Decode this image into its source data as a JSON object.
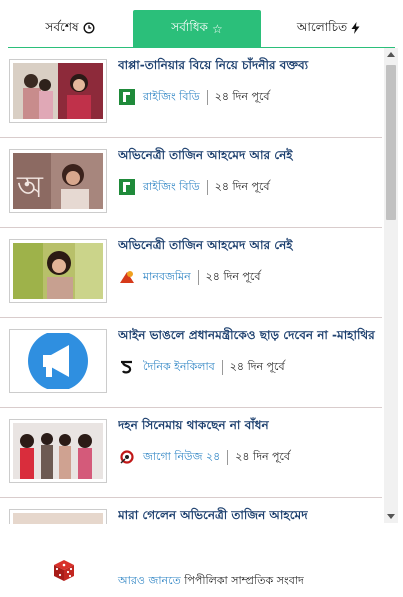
{
  "tabs": [
    {
      "label": "সর্বশেষ",
      "icon": "clock-icon",
      "active": false
    },
    {
      "label": "সর্বাধিক",
      "icon": "star-icon",
      "active": true
    },
    {
      "label": "আলোচিত",
      "icon": "bolt-icon",
      "active": false
    }
  ],
  "colors": {
    "accent": "#2bbf7a",
    "title": "#1c3f6e",
    "source": "#2e84c4"
  },
  "feed": [
    {
      "title": "বাপ্পা-তানিয়ার বিয়ে নিয়ে চাঁদনীর বক্তব্য",
      "source": "রাইজিং বিডি",
      "source_logo": "rising-bd-logo",
      "time": "২৪ দিন পূর্বে"
    },
    {
      "title": "অভিনেত্রী তাজিন আহমেদ আর নেই",
      "source": "রাইজিং বিডি",
      "source_logo": "rising-bd-logo",
      "time": "২৪ দিন পূর্বে"
    },
    {
      "title": "অভিনেত্রী তাজিন আহমেদ আর নেই",
      "source": "মানবজমিন",
      "source_logo": "manabzamin-logo",
      "time": "২৪ দিন পূর্বে"
    },
    {
      "title": "আইন ভাঙলে প্রধানমন্ত্রীকেও ছাড় দেবেন না -মাহাথির",
      "source": "দৈনিক ইনকিলাব",
      "source_logo": "inqilab-logo",
      "time": "২৪ দিন পূর্বে"
    },
    {
      "title": "দহন সিনেমায় থাকছেন না বাঁধন",
      "source": "জাগো নিউজ ২৪",
      "source_logo": "jagonews-logo",
      "time": "২৪ দিন পূর্বে"
    },
    {
      "title": "মারা গেলেন অভিনেত্রী তাজিন আহমেদ",
      "source": "",
      "source_logo": "",
      "time": ""
    }
  ],
  "footer": {
    "prefix": "আরও জানতে",
    "text": "পিপীলিকা সাম্প্রতিক সংবাদ"
  }
}
